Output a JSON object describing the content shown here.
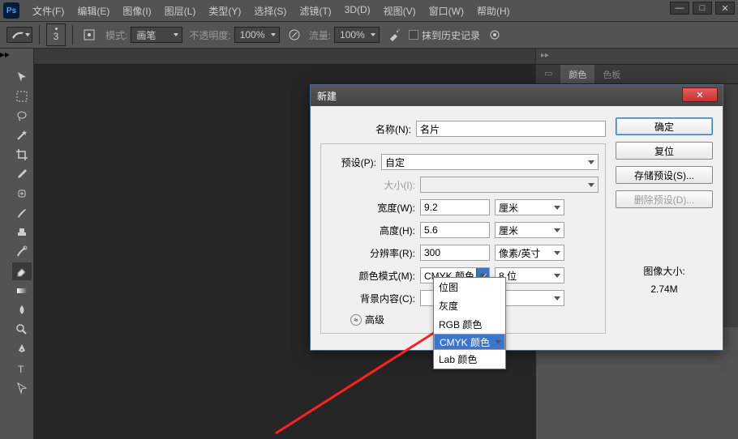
{
  "app": {
    "logo": "Ps"
  },
  "menu": {
    "file": "文件(F)",
    "edit": "编辑(E)",
    "image": "图像(I)",
    "layer": "图层(L)",
    "type": "类型(Y)",
    "select": "选择(S)",
    "filter": "滤镜(T)",
    "3d": "3D(D)",
    "view": "视图(V)",
    "window": "窗口(W)",
    "help": "帮助(H)"
  },
  "options": {
    "size_num": "3",
    "mode_label": "模式:",
    "mode_value": "画笔",
    "opacity_label": "不透明度:",
    "opacity_value": "100%",
    "flow_label": "流量:",
    "flow_value": "100%",
    "erase_history": "抹到历史记录"
  },
  "panels": {
    "tabs": {
      "t1": "",
      "color": "颜色",
      "swatches": "色板"
    }
  },
  "dialog": {
    "title": "新建",
    "name_label": "名称(N):",
    "name_value": "名片",
    "preset_label": "预设(P):",
    "preset_value": "自定",
    "size_label": "大小(I):",
    "size_value": "",
    "width_label": "宽度(W):",
    "width_value": "9.2",
    "width_unit": "厘米",
    "height_label": "高度(H):",
    "height_value": "5.6",
    "height_unit": "厘米",
    "res_label": "分辨率(R):",
    "res_value": "300",
    "res_unit": "像素/英寸",
    "mode_label": "颜色模式(M):",
    "mode_value": "CMYK 颜色",
    "depth_value": "8 位",
    "bg_label": "背景内容(C):",
    "bg_value": "",
    "advanced": "高级",
    "mode_options": {
      "bitmap": "位图",
      "gray": "灰度",
      "rgb": "RGB 颜色",
      "cmyk": "CMYK 颜色",
      "lab": "Lab 颜色"
    },
    "buttons": {
      "ok": "确定",
      "reset": "复位",
      "save_preset": "存储预设(S)...",
      "delete_preset": "删除预设(D)..."
    },
    "info": {
      "label": "图像大小:",
      "value": "2.74M"
    }
  }
}
